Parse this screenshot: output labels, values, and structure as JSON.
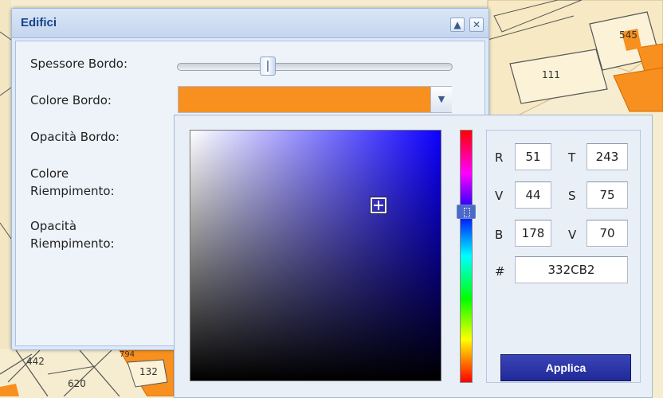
{
  "map": {
    "parcel_numbers": [
      "545",
      "111",
      "442",
      "794",
      "132",
      "620"
    ]
  },
  "panel": {
    "title": "Edifici",
    "collapse_icon": "triangle-up-icon",
    "close_icon": "close-icon",
    "labels": {
      "border_thickness": "Spessore Bordo:",
      "border_color": "Colore Bordo:",
      "border_opacity": "Opacità Bordo:",
      "fill_color_line1": "Colore",
      "fill_color_line2": "Riempimento:",
      "fill_opacity_line1": "Opacità",
      "fill_opacity_line2": "Riempimento:"
    },
    "border_thickness_level": 0.33,
    "border_color_value": "#f7901e"
  },
  "picker": {
    "r_label": "R",
    "r": "51",
    "g_label": "V",
    "g": "44",
    "b_label": "B",
    "b": "178",
    "h_label": "T",
    "h": "243",
    "s_label": "S",
    "s": "75",
    "v_label": "V",
    "v": "70",
    "hex_label": "#",
    "hex": "332CB2",
    "apply_label": "Applica",
    "hue_color": "#1e00ff"
  },
  "colors": {
    "accent": "#15428b",
    "apply_bg": "#2a34a6",
    "map_fill": "#f6edd0",
    "map_outline": "#f7901e"
  }
}
